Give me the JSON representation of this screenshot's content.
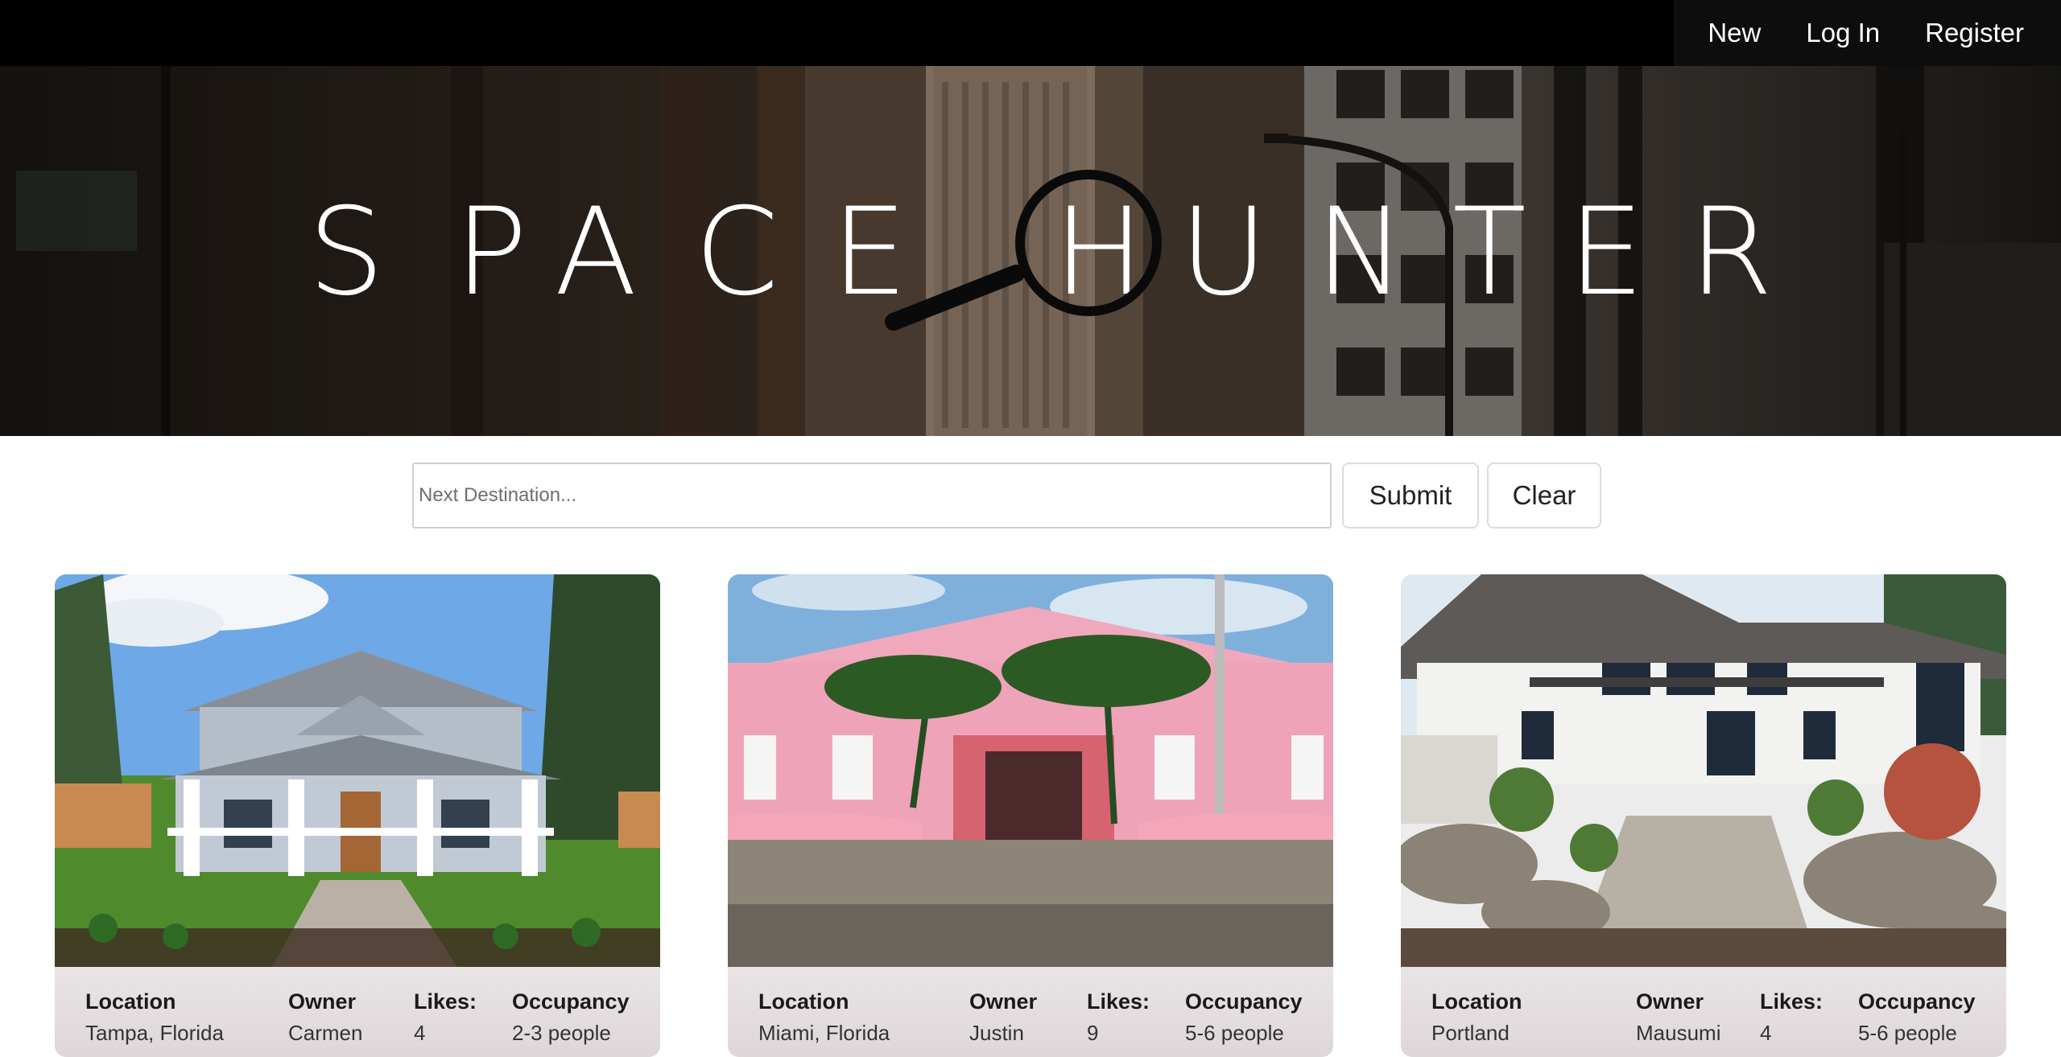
{
  "nav": {
    "items": [
      {
        "label": "New"
      },
      {
        "label": "Log In"
      },
      {
        "label": "Register"
      }
    ]
  },
  "hero": {
    "title_letters": [
      "S",
      "P",
      "A",
      "C",
      "E",
      "H",
      "U",
      "N",
      "T",
      "E",
      "R"
    ]
  },
  "search": {
    "placeholder": "Next Destination...",
    "submit_label": "Submit",
    "clear_label": "Clear"
  },
  "card_labels": {
    "location": "Location",
    "owner": "Owner",
    "likes": "Likes:",
    "occupancy": "Occupancy"
  },
  "listings": [
    {
      "location": "Tampa, Florida",
      "owner": "Carmen",
      "likes": "4",
      "occupancy": "2-3 people"
    },
    {
      "location": "Miami, Florida",
      "owner": "Justin",
      "likes": "9",
      "occupancy": "5-6 people"
    },
    {
      "location": "Portland",
      "owner": "Mausumi",
      "likes": "4",
      "occupancy": "5-6 people"
    }
  ],
  "colors": {
    "navbar": "#000000",
    "card_footer": "#e6e0e1"
  }
}
